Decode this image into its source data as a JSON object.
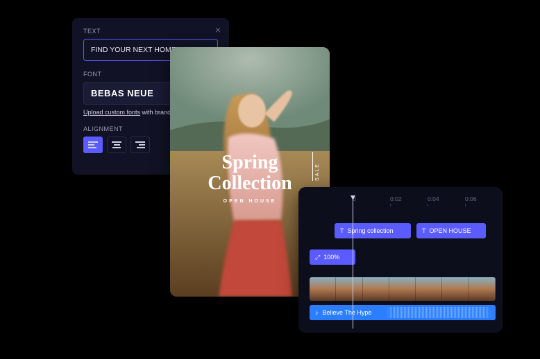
{
  "colors": {
    "accent": "#5b5cff",
    "panel": "#111225",
    "timeline_bg": "#0d0e1c",
    "audio": "#2b7eff"
  },
  "text_panel": {
    "text_label": "TEXT",
    "text_value": "FIND YOUR NEXT HOME",
    "font_label": "FONT",
    "font_value": "BEBAS NEUE",
    "upload_link": "Upload custom fonts",
    "upload_suffix": " with brand kit",
    "alignment_label": "ALIGNMENT",
    "alignment_selected": "left"
  },
  "preview": {
    "title_line1": "Spring",
    "title_line2": "Collection",
    "subtitle": "OPEN HOUSE",
    "side_text": "SALE"
  },
  "timeline": {
    "ticks": [
      "0",
      "0:02",
      "0:04",
      "0:06"
    ],
    "clips": {
      "text1": "Spring collection",
      "text2": "OPEN HOUSE",
      "scale": "100%"
    },
    "audio_label": "Believe The Hype"
  }
}
